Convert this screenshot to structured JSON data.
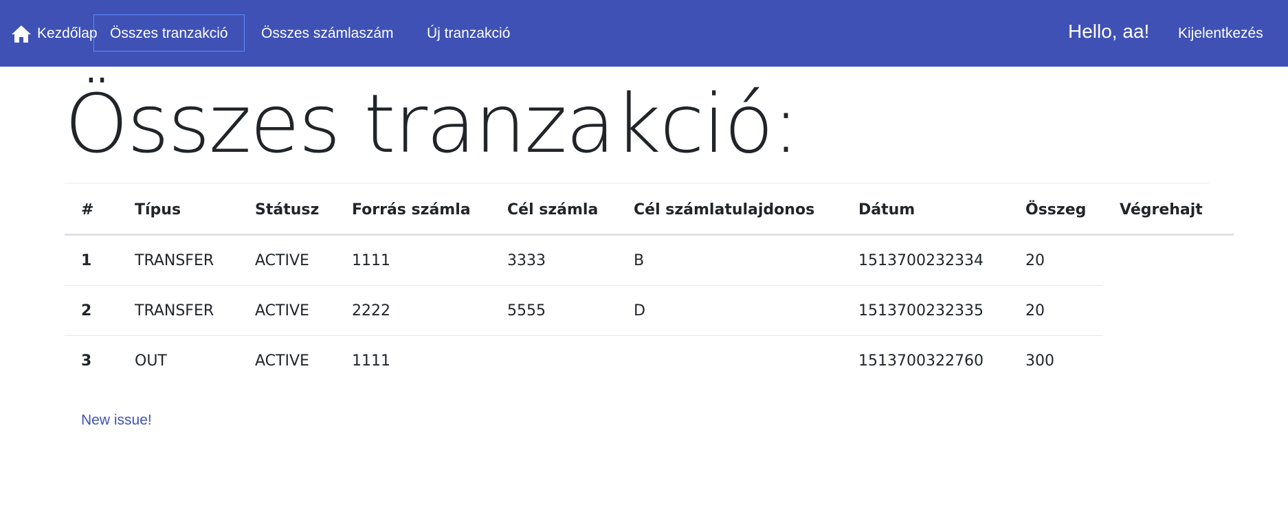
{
  "colors": {
    "navbar_background": "#3f51b5",
    "navbar_text": "#ffffff",
    "active_outline": "#5c8dff",
    "link": "#3f51b5",
    "heading_text": "#212529"
  },
  "navbar": {
    "home": {
      "icon": "home-icon",
      "label": "Kezdőlap"
    },
    "links": [
      {
        "label": "Összes tranzakció",
        "active": true
      },
      {
        "label": "Összes számlaszám",
        "active": false
      },
      {
        "label": "Új tranzakció",
        "active": false
      }
    ],
    "greeting": "Hello, aa!",
    "logout_label": "Kijelentkezés"
  },
  "main": {
    "title": "Összes tranzakció:",
    "table": {
      "headers": [
        "#",
        "Típus",
        "Státusz",
        "Forrás számla",
        "Cél számla",
        "Cél számlatulajdonos",
        "Dátum",
        "Összeg",
        "Végrehajt"
      ],
      "rows": [
        [
          "1",
          "TRANSFER",
          "ACTIVE",
          "1111",
          "3333",
          "B",
          "1513700232334",
          "20",
          ""
        ],
        [
          "2",
          "TRANSFER",
          "ACTIVE",
          "2222",
          "5555",
          "D",
          "1513700232335",
          "20",
          ""
        ],
        [
          "3",
          "OUT",
          "ACTIVE",
          "1111",
          "",
          "",
          "1513700322760",
          "300",
          ""
        ]
      ]
    },
    "new_issue_label": "New issue!"
  }
}
